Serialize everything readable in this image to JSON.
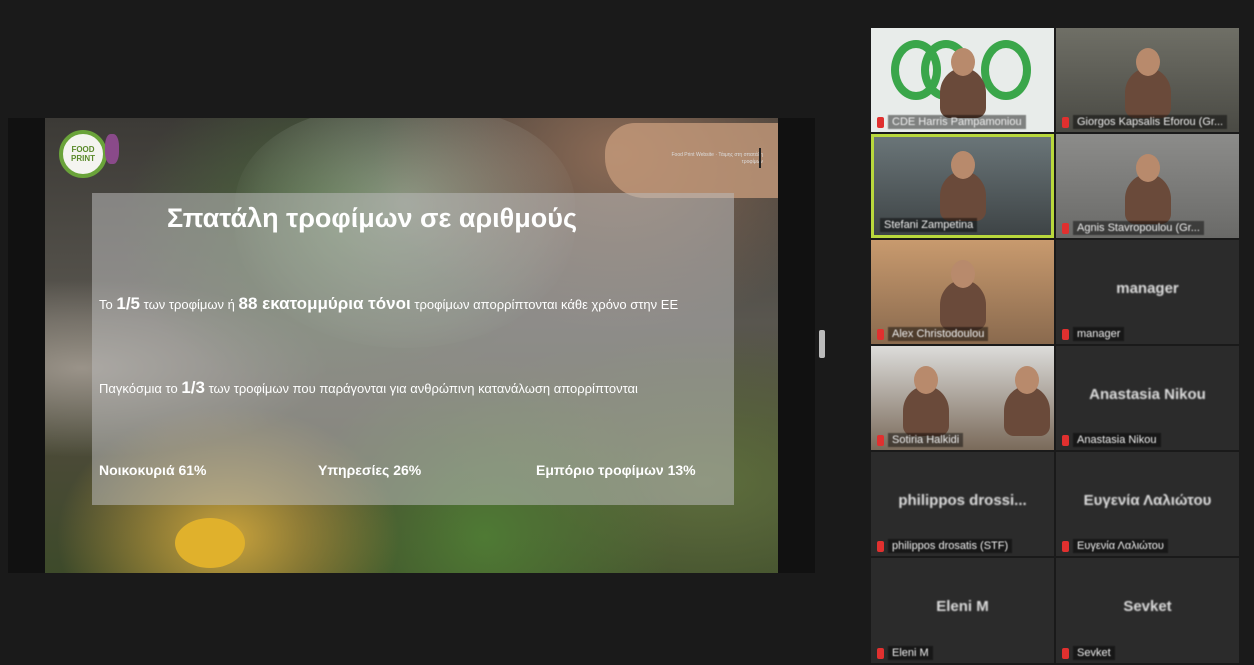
{
  "slide": {
    "logo_text": "FOOD PRINT",
    "top_right_text": "Food Print Website · Τάιμης στη σπατάλη τροφίμων",
    "title": "Σπατάλη τροφίμων σε αριθμούς",
    "para1": {
      "pre": "Το ",
      "big1": "1/5",
      "mid": " των τροφίμων ή ",
      "big2": "88 εκατομμύρια τόνοι",
      "post": " τροφίμων απορρίπτονται κάθε χρόνο στην ΕΕ"
    },
    "para2": {
      "pre": "Παγκόσμια το ",
      "big": "1/3",
      "post": " των τροφίμων που παράγονται για ανθρώπινη κατανάλωση απορρίπτονται"
    },
    "stats": [
      "Νοικοκυριά  61%",
      "Υπηρεσίες 26%",
      "Εμπόριο τροφίμων 13%"
    ]
  },
  "participants": [
    {
      "name": "CDE Harris Pampamoniou",
      "muted": true,
      "video": true,
      "active": false
    },
    {
      "name": "Giorgos Kapsalis Eforou (Gr...",
      "muted": true,
      "video": true,
      "active": false
    },
    {
      "name": "Stefani Zampetina",
      "muted": false,
      "video": true,
      "active": true
    },
    {
      "name": "Agnis Stavropoulou (Gr...",
      "muted": true,
      "video": true,
      "active": false
    },
    {
      "name": "Alex Christodoulou",
      "muted": true,
      "video": true,
      "active": false
    },
    {
      "name": "manager",
      "muted": true,
      "video": false,
      "active": false,
      "center": "manager"
    },
    {
      "name": "Sotiria Halkidi",
      "muted": true,
      "video": true,
      "active": false
    },
    {
      "name": "Anastasia Nikou",
      "muted": true,
      "video": false,
      "active": false,
      "center": "Anastasia Nikou"
    },
    {
      "name": "philippos drosatis (STF)",
      "muted": true,
      "video": false,
      "active": false,
      "center": "philippos drossi..."
    },
    {
      "name": "Ευγενία Λαλιώτου",
      "muted": true,
      "video": false,
      "active": false,
      "center": "Ευγενία Λαλιώτου"
    },
    {
      "name": "Eleni M",
      "muted": true,
      "video": false,
      "active": false,
      "center": "Eleni M"
    },
    {
      "name": "Sevket",
      "muted": true,
      "video": false,
      "active": false,
      "center": "Sevket"
    }
  ],
  "colors": {
    "active_border": "#b9d83c",
    "muted_icon": "#e0302f",
    "accent_green": "#3aa64a"
  }
}
